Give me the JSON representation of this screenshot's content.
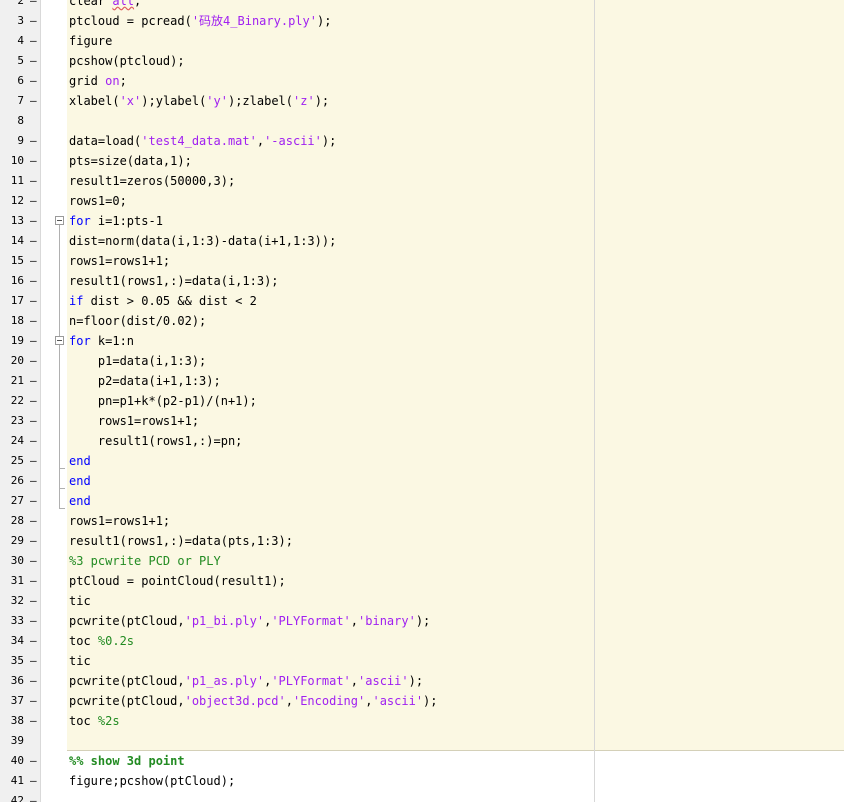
{
  "editor": {
    "lines": [
      {
        "n": "2",
        "tokens": [
          {
            "t": "clear ",
            "c": ""
          },
          {
            "t": "all",
            "c": "str typo"
          },
          {
            "t": ";",
            "c": ""
          }
        ]
      },
      {
        "n": "3",
        "tokens": [
          {
            "t": "ptcloud = pcread(",
            "c": ""
          },
          {
            "t": "'码放4_Binary.ply'",
            "c": "str"
          },
          {
            "t": ");",
            "c": ""
          }
        ]
      },
      {
        "n": "4",
        "tokens": [
          {
            "t": "figure",
            "c": ""
          }
        ]
      },
      {
        "n": "5",
        "tokens": [
          {
            "t": "pcshow(ptcloud);",
            "c": ""
          }
        ]
      },
      {
        "n": "6",
        "tokens": [
          {
            "t": "grid ",
            "c": ""
          },
          {
            "t": "on",
            "c": "str"
          },
          {
            "t": ";",
            "c": ""
          }
        ]
      },
      {
        "n": "7",
        "tokens": [
          {
            "t": "xlabel(",
            "c": ""
          },
          {
            "t": "'x'",
            "c": "str"
          },
          {
            "t": ");ylabel(",
            "c": ""
          },
          {
            "t": "'y'",
            "c": "str"
          },
          {
            "t": ");zlabel(",
            "c": ""
          },
          {
            "t": "'z'",
            "c": "str"
          },
          {
            "t": ");",
            "c": ""
          }
        ]
      },
      {
        "n": "8",
        "tokens": []
      },
      {
        "n": "9",
        "tokens": [
          {
            "t": "data=load(",
            "c": ""
          },
          {
            "t": "'test4_data.mat'",
            "c": "str"
          },
          {
            "t": ",",
            "c": ""
          },
          {
            "t": "'-ascii'",
            "c": "str"
          },
          {
            "t": ");",
            "c": ""
          }
        ]
      },
      {
        "n": "10",
        "tokens": [
          {
            "t": "pts=size(data,1);",
            "c": ""
          }
        ]
      },
      {
        "n": "11",
        "tokens": [
          {
            "t": "result1=zeros(50000,3);",
            "c": ""
          }
        ]
      },
      {
        "n": "12",
        "tokens": [
          {
            "t": "rows1=0;",
            "c": ""
          }
        ]
      },
      {
        "n": "13",
        "tokens": [
          {
            "t": "for",
            "c": "kw"
          },
          {
            "t": " i=1:pts-1",
            "c": ""
          }
        ]
      },
      {
        "n": "14",
        "tokens": [
          {
            "t": "dist=norm(data(i,1:3)-data(i+1,1:3));",
            "c": ""
          }
        ]
      },
      {
        "n": "15",
        "tokens": [
          {
            "t": "rows1=rows1+1;",
            "c": ""
          }
        ]
      },
      {
        "n": "16",
        "tokens": [
          {
            "t": "result1(rows1,:)=data(i,1:3);",
            "c": ""
          }
        ]
      },
      {
        "n": "17",
        "tokens": [
          {
            "t": "if",
            "c": "kw"
          },
          {
            "t": " dist > 0.05 && dist < 2",
            "c": ""
          }
        ]
      },
      {
        "n": "18",
        "tokens": [
          {
            "t": "n=floor(dist/0.02);",
            "c": ""
          }
        ]
      },
      {
        "n": "19",
        "tokens": [
          {
            "t": "for",
            "c": "kw"
          },
          {
            "t": " k=1:n",
            "c": ""
          }
        ]
      },
      {
        "n": "20",
        "tokens": [
          {
            "t": "    p1=data(i,1:3);",
            "c": ""
          }
        ]
      },
      {
        "n": "21",
        "tokens": [
          {
            "t": "    p2=data(i+1,1:3);",
            "c": ""
          }
        ]
      },
      {
        "n": "22",
        "tokens": [
          {
            "t": "    pn=p1+k*(p2-p1)/(n+1);",
            "c": ""
          }
        ]
      },
      {
        "n": "23",
        "tokens": [
          {
            "t": "    rows1=rows1+1;",
            "c": ""
          }
        ]
      },
      {
        "n": "24",
        "tokens": [
          {
            "t": "    result1(rows1,:)=pn;",
            "c": ""
          }
        ]
      },
      {
        "n": "25",
        "tokens": [
          {
            "t": "end",
            "c": "kw"
          }
        ]
      },
      {
        "n": "26",
        "tokens": [
          {
            "t": "end",
            "c": "kw"
          }
        ]
      },
      {
        "n": "27",
        "tokens": [
          {
            "t": "end",
            "c": "kw"
          }
        ]
      },
      {
        "n": "28",
        "tokens": [
          {
            "t": "rows1=rows1+1;",
            "c": ""
          }
        ]
      },
      {
        "n": "29",
        "tokens": [
          {
            "t": "result1(rows1,:)=data(pts,1:3);",
            "c": ""
          }
        ]
      },
      {
        "n": "30",
        "tokens": [
          {
            "t": "%3 pcwrite PCD or PLY",
            "c": "cmt"
          }
        ]
      },
      {
        "n": "31",
        "tokens": [
          {
            "t": "ptCloud = pointCloud(result1);",
            "c": ""
          }
        ]
      },
      {
        "n": "32",
        "tokens": [
          {
            "t": "tic",
            "c": ""
          }
        ]
      },
      {
        "n": "33",
        "tokens": [
          {
            "t": "pcwrite(ptCloud,",
            "c": ""
          },
          {
            "t": "'p1_bi.ply'",
            "c": "str"
          },
          {
            "t": ",",
            "c": ""
          },
          {
            "t": "'PLYFormat'",
            "c": "str"
          },
          {
            "t": ",",
            "c": ""
          },
          {
            "t": "'binary'",
            "c": "str"
          },
          {
            "t": ");",
            "c": ""
          }
        ]
      },
      {
        "n": "34",
        "tokens": [
          {
            "t": "toc ",
            "c": ""
          },
          {
            "t": "%0.2s",
            "c": "cmt"
          }
        ]
      },
      {
        "n": "35",
        "tokens": [
          {
            "t": "tic",
            "c": ""
          }
        ]
      },
      {
        "n": "36",
        "tokens": [
          {
            "t": "pcwrite(ptCloud,",
            "c": ""
          },
          {
            "t": "'p1_as.ply'",
            "c": "str"
          },
          {
            "t": ",",
            "c": ""
          },
          {
            "t": "'PLYFormat'",
            "c": "str"
          },
          {
            "t": ",",
            "c": ""
          },
          {
            "t": "'ascii'",
            "c": "str"
          },
          {
            "t": ");",
            "c": ""
          }
        ]
      },
      {
        "n": "37",
        "tokens": [
          {
            "t": "pcwrite(ptCloud,",
            "c": ""
          },
          {
            "t": "'object3d.pcd'",
            "c": "str"
          },
          {
            "t": ",",
            "c": ""
          },
          {
            "t": "'Encoding'",
            "c": "str"
          },
          {
            "t": ",",
            "c": ""
          },
          {
            "t": "'ascii'",
            "c": "str"
          },
          {
            "t": ");",
            "c": ""
          }
        ]
      },
      {
        "n": "38",
        "tokens": [
          {
            "t": "toc ",
            "c": ""
          },
          {
            "t": "%2s",
            "c": "cmt"
          }
        ]
      },
      {
        "n": "39",
        "tokens": []
      },
      {
        "n": "40",
        "tokens": [
          {
            "t": "%% show 3d point",
            "c": "cellhdr"
          }
        ]
      },
      {
        "n": "41",
        "tokens": [
          {
            "t": "figure;pcshow(ptCloud);",
            "c": ""
          }
        ]
      },
      {
        "n": "42",
        "tokens": []
      }
    ],
    "dash_lines": [
      "2",
      "3",
      "4",
      "5",
      "6",
      "7",
      "9",
      "10",
      "11",
      "12",
      "13",
      "14",
      "15",
      "16",
      "17",
      "18",
      "19",
      "20",
      "21",
      "22",
      "23",
      "24",
      "25",
      "26",
      "27",
      "28",
      "29",
      "30",
      "31",
      "32",
      "33",
      "34",
      "35",
      "36",
      "37",
      "38",
      "40",
      "41",
      "42"
    ],
    "colors": {
      "keyword": "#0000ff",
      "string": "#a020f0",
      "comment": "#228b22",
      "cell_background": "#fbf8e3"
    }
  }
}
